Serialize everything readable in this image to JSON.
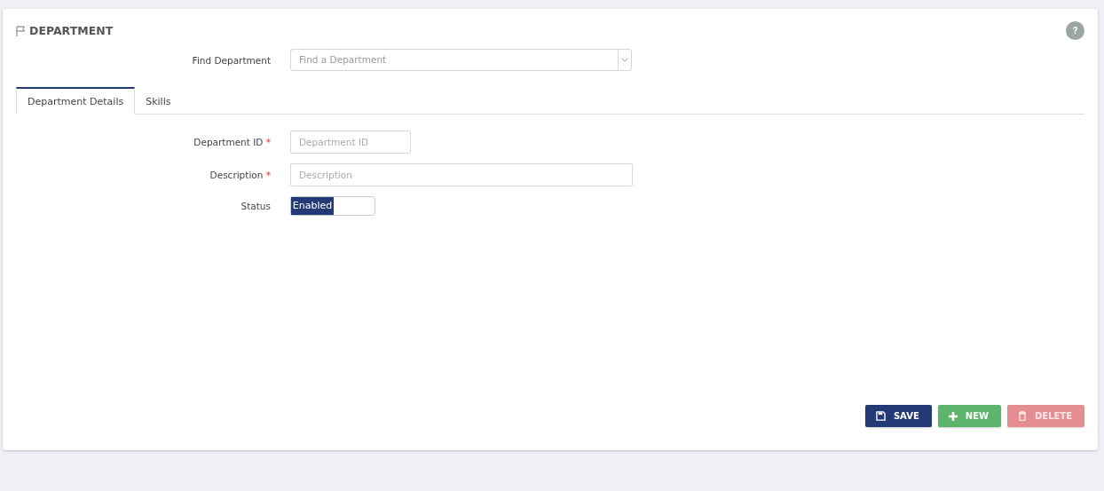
{
  "page": {
    "title": "DEPARTMENT",
    "help": "?"
  },
  "finder": {
    "label": "Find Department",
    "placeholder": "Find a Department"
  },
  "tabs": [
    {
      "label": "Department Details",
      "selected": true
    },
    {
      "label": "Skills",
      "selected": false
    }
  ],
  "fields": [
    {
      "kind": "short-text",
      "label": "Department ID",
      "required_mark": "*",
      "placeholder": "Department ID"
    },
    {
      "kind": "long-text",
      "label": "Description",
      "required_mark": "*",
      "placeholder": "Description"
    },
    {
      "kind": "toggle",
      "label": "Status",
      "on": true,
      "value": "Enabled"
    }
  ],
  "buttons": [
    {
      "kind": "save",
      "label": "SAVE",
      "disabled": false
    },
    {
      "kind": "new",
      "label": "NEW",
      "disabled": false
    },
    {
      "kind": "delete",
      "label": "DELETE",
      "disabled": true
    }
  ]
}
